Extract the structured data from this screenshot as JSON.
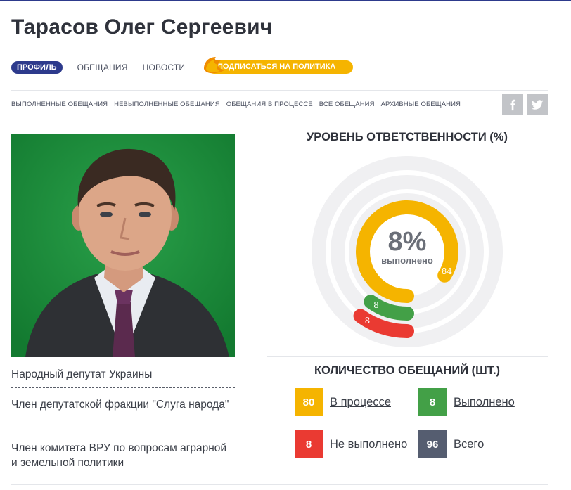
{
  "page": {
    "title": "Тарасов Олег Сергеевич"
  },
  "nav": {
    "items": [
      {
        "label": "ПРОФИЛЬ",
        "active": true
      },
      {
        "label": "ОБЕЩАНИЯ"
      },
      {
        "label": "НОВОСТИ"
      }
    ],
    "subscribe_label": "ПОДПИСАТЬСЯ НА ПОЛИТИКА"
  },
  "filters": [
    "ВЫПОЛНЕННЫЕ ОБЕЩАНИЯ",
    "НЕВЫПОЛНЕННЫЕ ОБЕЩАНИЯ",
    "ОБЕЩАНИЯ В ПРОЦЕССЕ",
    "ВСЕ ОБЕЩАНИЯ",
    "АРХИВНЫЕ ОБЕЩАНИЯ"
  ],
  "social": {
    "icons": [
      "facebook-icon",
      "twitter-icon"
    ]
  },
  "profile": {
    "roles": [
      "Народный депутат Украины",
      "Член депутатской фракции \"Слуга народа\"",
      "Член комитета ВРУ по вопросам аграрной и земельной политики"
    ]
  },
  "responsibility": {
    "heading": "УРОВЕНЬ ОТВЕТСТВЕННОСТИ (%)",
    "percent_text": "8%",
    "percent_caption": "выполнено",
    "rings": [
      {
        "key": "in_progress",
        "value": 84,
        "label": "84",
        "color": "#f5b400"
      },
      {
        "key": "done",
        "value": 8,
        "label": "8",
        "color": "#43a047"
      },
      {
        "key": "failed",
        "value": 8,
        "label": "8",
        "color": "#ea3a32"
      }
    ]
  },
  "counts": {
    "heading": "КОЛИЧЕСТВО ОБЕЩАНИЙ (ШТ.)",
    "items": [
      {
        "value": "80",
        "label": "В процессе",
        "color": "#f5b400"
      },
      {
        "value": "8",
        "label": "Выполнено",
        "color": "#43a047"
      },
      {
        "value": "8",
        "label": "Не выполнено",
        "color": "#ea3a32"
      },
      {
        "value": "96",
        "label": "Всего",
        "color": "#555d70"
      }
    ]
  },
  "colors": {
    "brand": "#2d3a8c",
    "accent": "#f5b400"
  }
}
